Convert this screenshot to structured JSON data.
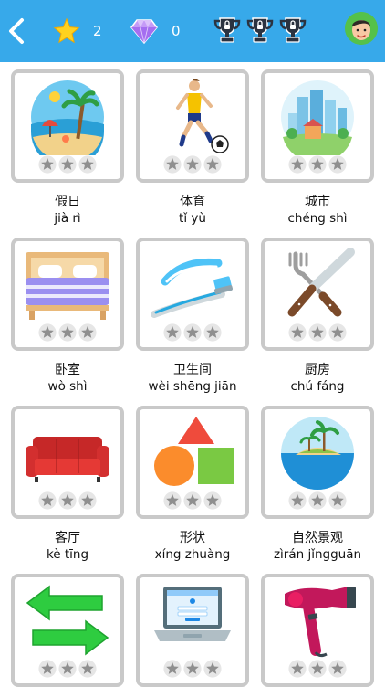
{
  "header": {
    "stars_count": "2",
    "gems_count": "0",
    "trophies": [
      "trophy-locked",
      "trophy-locked",
      "trophy-locked"
    ],
    "colors": {
      "bar": "#37a9ea",
      "star": "#ffd21f",
      "gem": "#b07cf0"
    }
  },
  "categories": [
    {
      "chinese": "假日",
      "pinyin": "jià rì",
      "icon": "beach-icon",
      "rating": 0
    },
    {
      "chinese": "体育",
      "pinyin": "tǐ yù",
      "icon": "soccer-player-icon",
      "rating": 0
    },
    {
      "chinese": "城市",
      "pinyin": "chéng shì",
      "icon": "city-icon",
      "rating": 0
    },
    {
      "chinese": "卧室",
      "pinyin": "wò shì",
      "icon": "bed-icon",
      "rating": 0
    },
    {
      "chinese": "卫生间",
      "pinyin": "wèi shēng jiān",
      "icon": "toothbrush-icon",
      "rating": 0
    },
    {
      "chinese": "厨房",
      "pinyin": "chú fáng",
      "icon": "fork-knife-icon",
      "rating": 0
    },
    {
      "chinese": "客厅",
      "pinyin": "kè tīng",
      "icon": "sofa-icon",
      "rating": 0
    },
    {
      "chinese": "形状",
      "pinyin": "xíng zhuàng",
      "icon": "shapes-icon",
      "rating": 0
    },
    {
      "chinese": "自然景观",
      "pinyin": "zìrán jǐngguān",
      "icon": "island-icon",
      "rating": 0
    },
    {
      "chinese": "",
      "pinyin": "",
      "icon": "arrows-icon",
      "rating": 0
    },
    {
      "chinese": "",
      "pinyin": "",
      "icon": "laptop-icon",
      "rating": 0
    },
    {
      "chinese": "",
      "pinyin": "",
      "icon": "hair-dryer-icon",
      "rating": 0
    }
  ]
}
